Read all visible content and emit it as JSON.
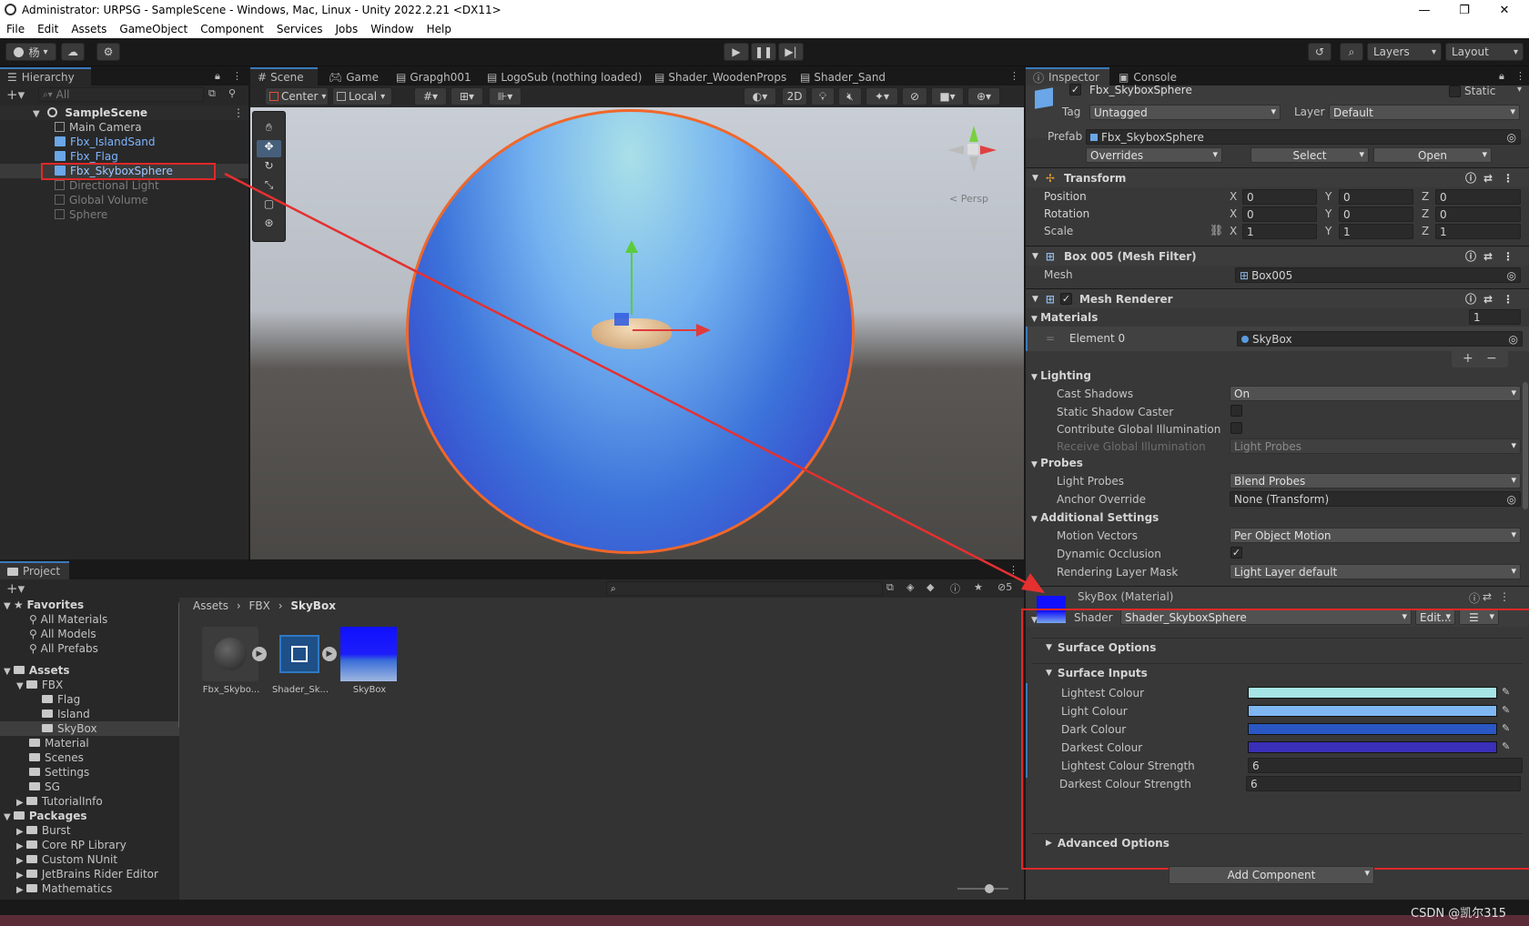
{
  "window": {
    "title": "Administrator: URPSG - SampleScene - Windows, Mac, Linux - Unity 2022.2.21 <DX11>"
  },
  "menu": [
    "File",
    "Edit",
    "Assets",
    "GameObject",
    "Component",
    "Services",
    "Jobs",
    "Window",
    "Help"
  ],
  "toolbar": {
    "account": "杨",
    "layers": "Layers",
    "layout": "Layout"
  },
  "hierarchy": {
    "tab": "Hierarchy",
    "search_placeholder": "All",
    "scene": "SampleScene",
    "items": [
      {
        "label": "Main Camera",
        "style": "normal"
      },
      {
        "label": "Fbx_IslandSand",
        "style": "prefab"
      },
      {
        "label": "Fbx_Flag",
        "style": "prefab"
      },
      {
        "label": "Fbx_SkyboxSphere",
        "style": "selected"
      },
      {
        "label": "Directional Light",
        "style": "disabled"
      },
      {
        "label": "Global Volume",
        "style": "disabled"
      },
      {
        "label": "Sphere",
        "style": "disabled"
      }
    ]
  },
  "scene_tabs": [
    "Scene",
    "Game",
    "Grapgh001",
    "LogoSub (nothing loaded)",
    "Shader_WoodenProps",
    "Shader_Sand"
  ],
  "scene_toolbar": {
    "pivot": "Center",
    "space": "Local",
    "mode2d": "2D",
    "persp": "< Persp"
  },
  "project": {
    "tab": "Project",
    "breadcrumb": [
      "Assets",
      "FBX",
      "SkyBox"
    ],
    "hidden_count": "5",
    "favorites_label": "Favorites",
    "favorites": [
      "All Materials",
      "All Models",
      "All Prefabs"
    ],
    "assets_label": "Assets",
    "fbx": "FBX",
    "fbx_children": [
      "Flag",
      "Island",
      "SkyBox"
    ],
    "asset_folders": [
      "Material",
      "Scenes",
      "Settings",
      "SG",
      "TutorialInfo"
    ],
    "packages_label": "Packages",
    "packages": [
      "Burst",
      "Core RP Library",
      "Custom NUnit",
      "JetBrains Rider Editor",
      "Mathematics"
    ],
    "files": [
      "Fbx_Skybo...",
      "Shader_Sk...",
      "SkyBox"
    ]
  },
  "inspector": {
    "tabs": [
      "Inspector",
      "Console"
    ],
    "object_name": "Fbx_SkyboxSphere",
    "static_label": "Static",
    "tag_label": "Tag",
    "tag": "Untagged",
    "layer_label": "Layer",
    "layer": "Default",
    "prefab_label": "Prefab",
    "prefab": "Fbx_SkyboxSphere",
    "overrides": "Overrides",
    "select": "Select",
    "open": "Open",
    "transform": {
      "title": "Transform",
      "rows": [
        {
          "label": "Position",
          "x": "0",
          "y": "0",
          "z": "0"
        },
        {
          "label": "Rotation",
          "x": "0",
          "y": "0",
          "z": "0"
        },
        {
          "label": "Scale",
          "x": "1",
          "y": "1",
          "z": "1"
        }
      ]
    },
    "mesh_filter": {
      "title": "Box 005 (Mesh Filter)",
      "mesh_label": "Mesh",
      "mesh": "Box005"
    },
    "mesh_renderer": {
      "title": "Mesh Renderer",
      "materials_label": "Materials",
      "materials_count": "1",
      "element_label": "Element 0",
      "element_value": "SkyBox",
      "lighting_label": "Lighting",
      "cast_shadows_label": "Cast Shadows",
      "cast_shadows": "On",
      "static_shadow_label": "Static Shadow Caster",
      "contribute_gi_label": "Contribute Global Illumination",
      "receive_gi_label": "Receive Global Illumination",
      "receive_gi": "Light Probes",
      "probes_label": "Probes",
      "light_probes_label": "Light Probes",
      "light_probes": "Blend Probes",
      "anchor_label": "Anchor Override",
      "anchor": "None (Transform)",
      "additional_label": "Additional Settings",
      "motion_label": "Motion Vectors",
      "motion": "Per Object Motion",
      "occlusion_label": "Dynamic Occlusion",
      "layer_mask_label": "Rendering Layer Mask",
      "layer_mask": "Light Layer default"
    },
    "material": {
      "title": "SkyBox (Material)",
      "shader_label": "Shader",
      "shader": "Shader_SkyboxSphere",
      "edit": "Edit...",
      "surface_options": "Surface Options",
      "surface_inputs": "Surface Inputs",
      "colors": [
        {
          "label": "Lightest Colour",
          "color": "#a7e4e6"
        },
        {
          "label": "Light Colour",
          "color": "#7fb7f2"
        },
        {
          "label": "Dark Colour",
          "color": "#2a57c4"
        },
        {
          "label": "Darkest Colour",
          "color": "#3a2fb8"
        }
      ],
      "lightest_strength_label": "Lightest Colour Strength",
      "lightest_strength": "6",
      "darkest_strength_label": "Darkest Colour Strength",
      "darkest_strength": "6",
      "advanced": "Advanced Options"
    },
    "add_component": "Add Component"
  },
  "watermark": "CSDN @凯尔315"
}
